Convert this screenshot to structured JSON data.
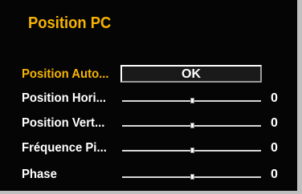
{
  "menu": {
    "title": "Position PC",
    "title_color": "#f6b400",
    "auto_position": {
      "label": "Position Auto...",
      "button_label": "OK"
    },
    "settings": [
      {
        "label": "Position Hori...",
        "value": "0",
        "level_fraction": 0.5
      },
      {
        "label": "Position Vert...",
        "value": "0",
        "level_fraction": 0.5
      },
      {
        "label": "Fréquence Pi...",
        "value": "0",
        "level_fraction": 0.5
      },
      {
        "label": "Phase",
        "value": "0",
        "level_fraction": 0.5
      }
    ]
  }
}
